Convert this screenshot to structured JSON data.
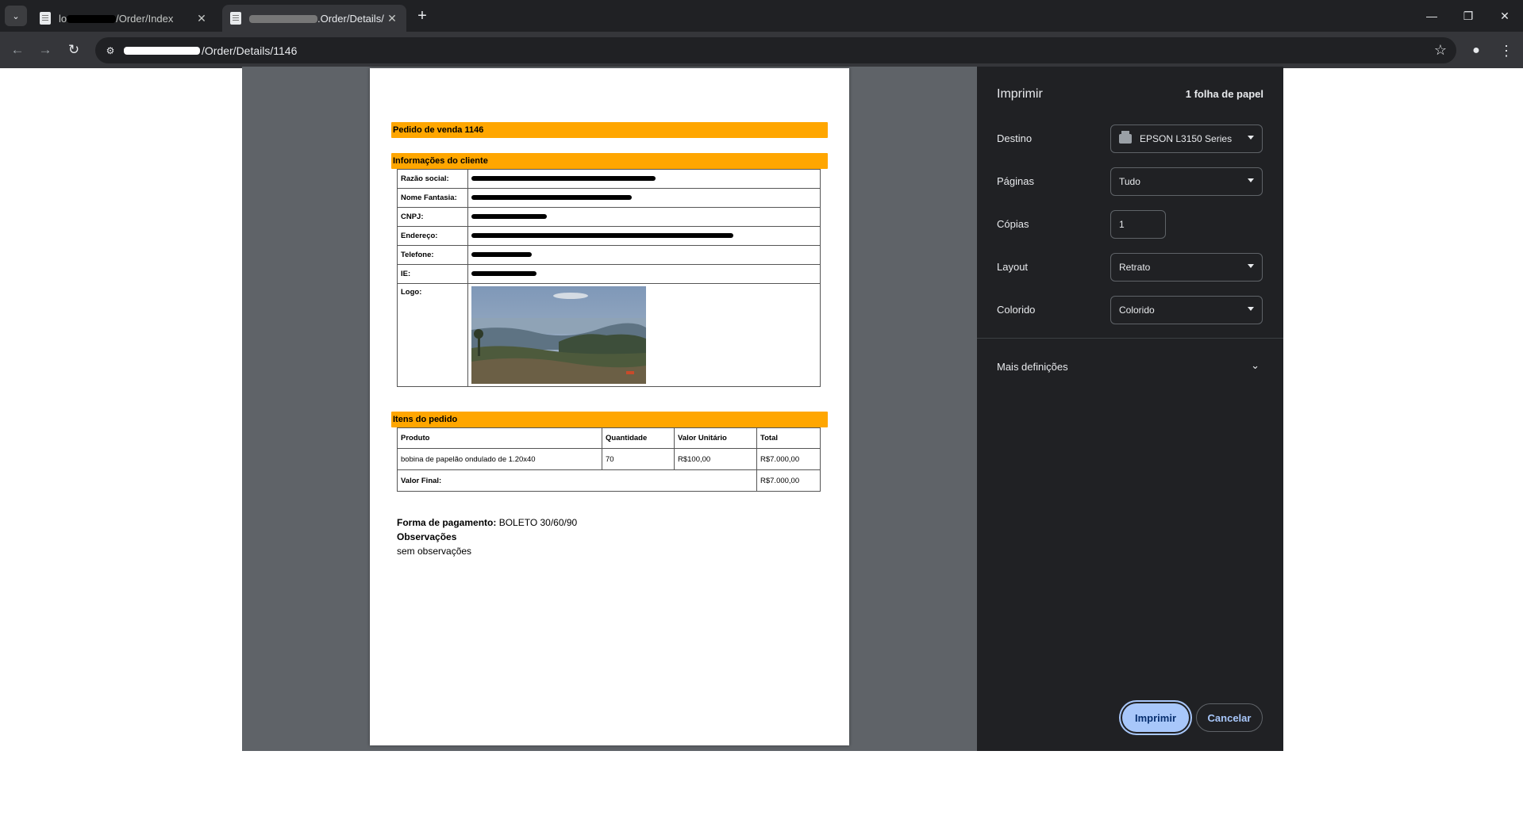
{
  "browser": {
    "tabs": [
      {
        "title_visible": "/Order/Index",
        "title_prefix": "lo",
        "active": false
      },
      {
        "title_visible": ".Order/Details/",
        "title_prefix": "",
        "active": true
      }
    ],
    "new_tab_label": "+",
    "window_controls": {
      "minimize": "—",
      "restore": "❐",
      "close": "✕"
    },
    "nav": {
      "back": "←",
      "forward": "→",
      "reload": "↻"
    },
    "url_visible": "/Order/Details/1146",
    "icons": {
      "site_info": "tune-icon",
      "bookmark": "star-icon",
      "profile": "person-icon",
      "menu": "more-vert-icon"
    }
  },
  "document": {
    "order_title": "Pedido de venda 1146",
    "customer_section_title": "Informações do cliente",
    "customer_fields": [
      {
        "label": "Razão social:"
      },
      {
        "label": "Nome Fantasia:"
      },
      {
        "label": "CNPJ:"
      },
      {
        "label": "Endereço:"
      },
      {
        "label": "Telefone:"
      },
      {
        "label": "IE:"
      }
    ],
    "logo_label": "Logo:",
    "items_section_title": "Itens do pedido",
    "items_headers": [
      "Produto",
      "Quantidade",
      "Valor Unitário",
      "Total"
    ],
    "items": [
      {
        "produto": "bobina de papelão ondulado de 1.20x40",
        "quantidade": "70",
        "valor_unitario": "R$100,00",
        "total": "R$7.000,00"
      }
    ],
    "final_label": "Valor Final:",
    "final_value": "R$7.000,00",
    "payment_label": "Forma de pagamento:",
    "payment_value": "BOLETO 30/60/90",
    "notes_label": "Observações",
    "notes_value": "sem observações"
  },
  "print_dialog": {
    "title": "Imprimir",
    "sheets": "1 folha de papel",
    "destination_label": "Destino",
    "destination_value": "EPSON L3150 Series",
    "pages_label": "Páginas",
    "pages_value": "Tudo",
    "copies_label": "Cópias",
    "copies_value": "1",
    "layout_label": "Layout",
    "layout_value": "Retrato",
    "color_label": "Colorido",
    "color_value": "Colorido",
    "more_settings_label": "Mais definições",
    "print_button": "Imprimir",
    "cancel_button": "Cancelar"
  },
  "colors": {
    "section_band": "#ffa600",
    "panel_bg": "#202124",
    "preview_bg": "#5f6368",
    "primary_button": "#a8c7fa"
  }
}
